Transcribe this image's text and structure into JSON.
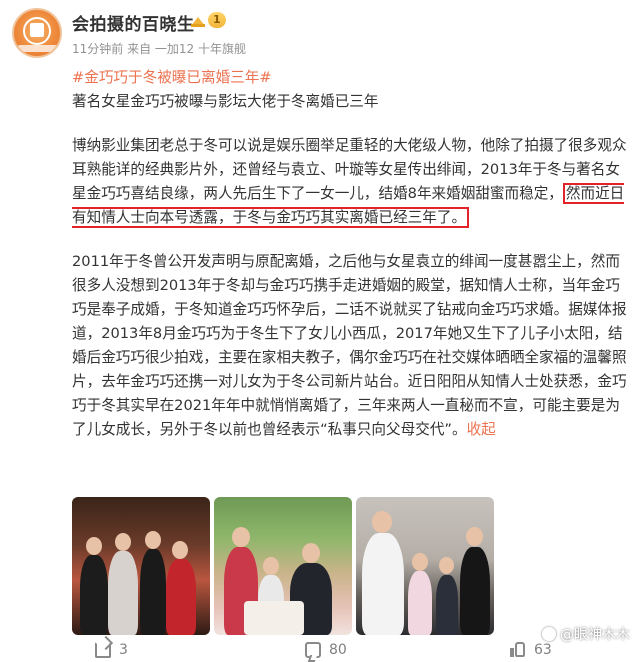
{
  "author": {
    "name": "会拍摄的百晓生",
    "vip_level": "1",
    "meta": "11分钟前  来自 一加12 十年旗舰"
  },
  "post": {
    "topic": "#金巧巧于冬被曝已离婚三年#",
    "headline": "著名女星金巧巧被曝与影坛大佬于冬离婚已三年",
    "p1_a": "博纳影业集团老总于冬可以说是娱乐圈举足重轻的大佬级人物，他除了拍摄了很多观众耳熟能详的经典影片外，还曾经与袁立、叶璇等女星传出绯闻，2013年于冬与著名女星金巧巧喜结良缘，两人先后生下了一女一儿，结婚8年来婚姻甜蜜而稳定，",
    "p1_highlight": "然而近日有知情人士向本号透露，于冬与金巧巧其实离婚已经三年了。",
    "p2": "2011年于冬曾公开发声明与原配离婚，之后他与女星袁立的绯闻一度甚嚣尘上，然而很多人没想到2013年于冬却与金巧巧携手走进婚姻的殿堂，据知情人士称，当年金巧巧是奉子成婚，于冬知道金巧巧怀孕后，二话不说就买了钻戒向金巧巧求婚。据媒体报道，2013年8月金巧巧为于冬生下了女儿小西瓜，2017年她又生下了儿子小太阳，结婚后金巧巧很少拍戏，主要在家相夫教子，偶尔金巧巧在社交媒体晒晒全家福的温馨照片，去年金巧巧还携一对儿女为于冬公司新片站台。近日阳阳从知情人士处获悉，金巧巧于冬其实早在2021年年中就悄悄离婚了，三年来两人一直秘而不宣，可能主要是为了儿女成长，另外于冬以前也曾经表示“私事只向父母交代”。",
    "collapse": "收起"
  },
  "watermark": "@眼神木木",
  "actions": {
    "repost_count": "3",
    "comment_count": "80",
    "like_count": "63"
  },
  "colors": {
    "link": "#eb7350",
    "highlight_box": "#e4222a",
    "meta": "#939393"
  }
}
